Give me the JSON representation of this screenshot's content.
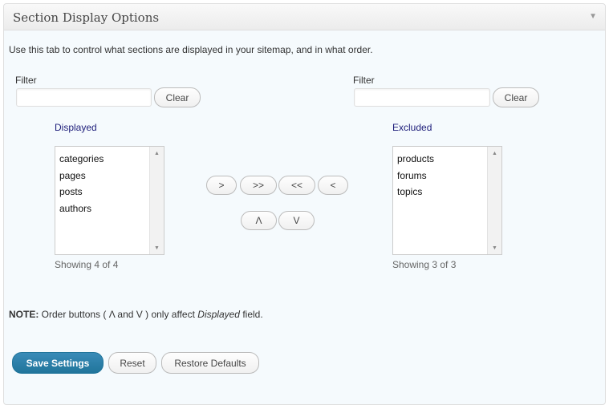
{
  "header": {
    "title": "Section Display Options",
    "collapse_icon": "▼"
  },
  "intro": "Use this tab to control what sections are displayed in your sitemap, and in what order.",
  "left": {
    "filter_label": "Filter",
    "filter_value": "",
    "clear_label": "Clear",
    "heading": "Displayed",
    "items": [
      "categories",
      "pages",
      "posts",
      "authors"
    ],
    "showing": "Showing 4 of 4"
  },
  "right": {
    "filter_label": "Filter",
    "filter_value": "",
    "clear_label": "Clear",
    "heading": "Excluded",
    "items": [
      "products",
      "forums",
      "topics"
    ],
    "showing": "Showing 3 of 3"
  },
  "move_buttons": {
    "move_right": ">",
    "move_all_right": ">>",
    "move_all_left": "<<",
    "move_left": "<",
    "move_up": "Λ",
    "move_down": "V"
  },
  "note": {
    "label": "NOTE:",
    "text_before": " Order buttons ( ",
    "up_symbol": "Λ",
    "and": " and ",
    "down_symbol": "V",
    "text_middle": " ) only affect ",
    "field": "Displayed",
    "text_after": " field."
  },
  "actions": {
    "save_label": "Save Settings",
    "reset_label": "Reset",
    "restore_label": "Restore Defaults"
  },
  "colors": {
    "primary": "#21759b",
    "heading_text": "#1d1d7a",
    "panel_bg": "#f5fafd"
  }
}
